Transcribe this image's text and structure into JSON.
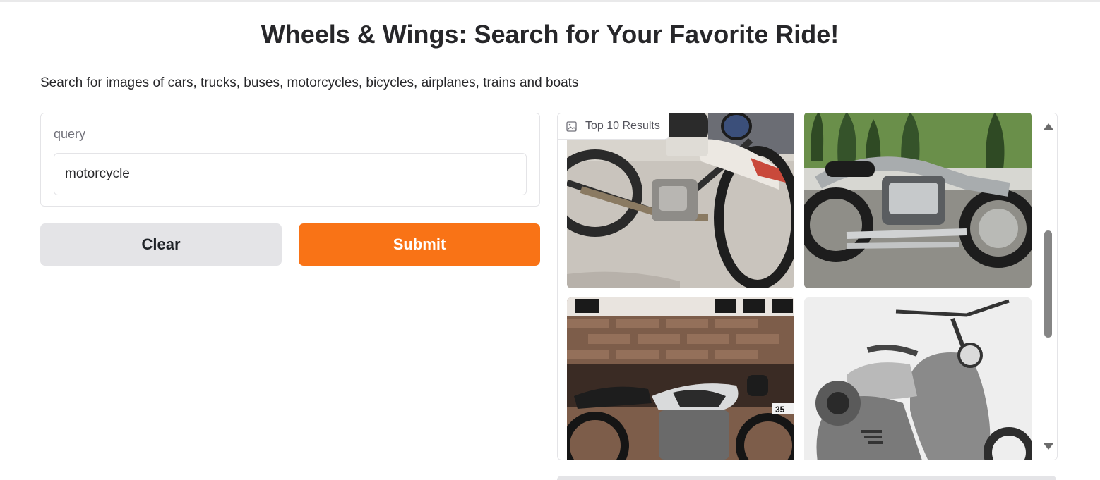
{
  "page": {
    "title": "Wheels & Wings: Search for Your Favorite Ride!",
    "description": "Search for images of cars, trucks, buses, motorcycles, bicycles, airplanes, trains and boats"
  },
  "query": {
    "label": "query",
    "value": "motorcycle"
  },
  "buttons": {
    "clear_label": "Clear",
    "submit_label": "Submit"
  },
  "gallery": {
    "label": "Top 10 Results",
    "icon": "image-icon",
    "items": [
      {
        "name": "result-image-1",
        "subject": "vintage motorcycle on pavement"
      },
      {
        "name": "result-image-2",
        "subject": "silver cruiser motorcycle"
      },
      {
        "name": "result-image-3",
        "subject": "classic motorcycle by brick wall"
      },
      {
        "name": "result-image-4",
        "subject": "vintage scooter"
      }
    ]
  },
  "colors": {
    "accent": "#f97316",
    "secondary_button": "#e4e4e7",
    "border": "#e4e4e7"
  }
}
